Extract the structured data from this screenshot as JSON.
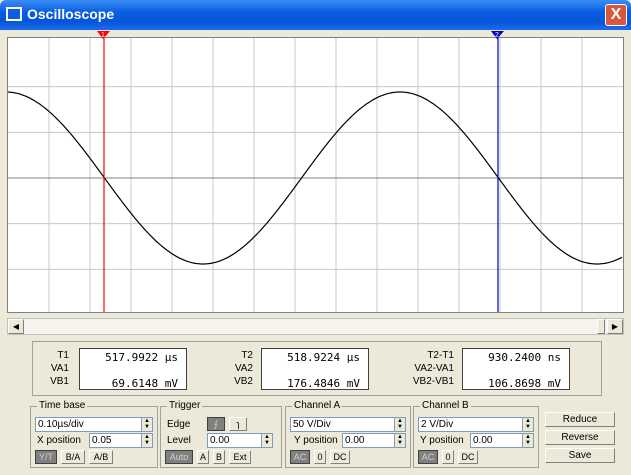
{
  "window": {
    "title": "Oscilloscope",
    "close": "X"
  },
  "cursors": {
    "c1": "1",
    "c2": "2"
  },
  "readout": {
    "t1_label": "T1",
    "va1_label": "VA1",
    "vb1_label": "VB1",
    "t1_value": "517.9922 µs",
    "vb1_value": "69.6148 mV",
    "t2_label": "T2",
    "va2_label": "VA2",
    "vb2_label": "VB2",
    "t2_value": "518.9224 µs",
    "vb2_value": "176.4846 mV",
    "dt_label": "T2-T1",
    "dva_label": "VA2-VA1",
    "dvb_label": "VB2-VB1",
    "dt_value": "930.2400 ns",
    "dvb_value": "106.8698 mV"
  },
  "timebase": {
    "title": "Time base",
    "scale": "0.10µs/div",
    "xpos_label": "X position",
    "xpos": "0.05",
    "modes": [
      "Y/T",
      "B/A",
      "A/B"
    ]
  },
  "trigger": {
    "title": "Trigger",
    "edge_label": "Edge",
    "level_label": "Level",
    "level": "0.00",
    "edge_rise": "⨍",
    "edge_fall": "ɿ",
    "sources": [
      "Auto",
      "A",
      "B",
      "Ext"
    ]
  },
  "channel_a": {
    "title": "Channel A",
    "scale": "50 V/Div",
    "ypos_label": "Y position",
    "ypos": "0.00",
    "coupling": [
      "AC",
      "0",
      "DC"
    ]
  },
  "channel_b": {
    "title": "Channel B",
    "scale": "2 V/Div",
    "ypos_label": "Y position",
    "ypos": "0.00",
    "coupling": [
      "AC",
      "0",
      "DC"
    ]
  },
  "actions": {
    "reduce": "Reduce",
    "reverse": "Reverse",
    "save": "Save"
  },
  "colors": {
    "cursor1": "#ff0000",
    "cursor2": "#0000c0",
    "trace": "#000000",
    "grid": "#c0c0c0"
  }
}
